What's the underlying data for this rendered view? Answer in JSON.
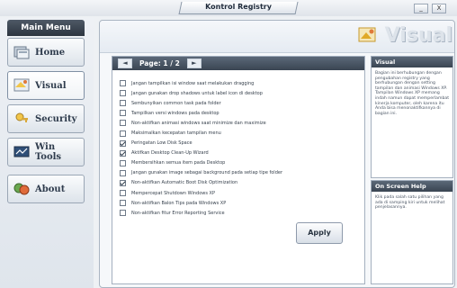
{
  "window": {
    "title": "Kontrol Registry",
    "minimize_label": "_",
    "close_label": "X"
  },
  "sidebar": {
    "title": "Main Menu",
    "items": [
      {
        "label": "Home",
        "icon": "home-icon"
      },
      {
        "label": "Visual",
        "icon": "visual-icon",
        "active": true
      },
      {
        "label": "Security",
        "icon": "security-icon"
      },
      {
        "label": "Win Tools",
        "icon": "wintools-icon"
      },
      {
        "label": "About",
        "icon": "about-icon"
      }
    ]
  },
  "banner": {
    "title": "Visual"
  },
  "options": {
    "page_label": "Page: 1 / 2",
    "prev_label": "◄",
    "next_label": "►",
    "items": [
      {
        "label": "Jangan tampilkan isi window saat melakukan dragging",
        "checked": false
      },
      {
        "label": "Jangan gunakan drop shadows untuk label icon di desktop",
        "checked": false
      },
      {
        "label": "Sembunyikan common task pada folder",
        "checked": false
      },
      {
        "label": "Tampilkan versi windows pada desktop",
        "checked": false
      },
      {
        "label": "Non-aktifkan animasi windows saat minimize dan maximize",
        "checked": false
      },
      {
        "label": "Maksimalkan kecepatan tampilan menu",
        "checked": false
      },
      {
        "label": "Peringatan Low Disk Space",
        "checked": true
      },
      {
        "label": "Aktifkan Desktop Clean-Up Wizard",
        "checked": true
      },
      {
        "label": "Membersihkan semua item pada Desktop",
        "checked": false
      },
      {
        "label": "Jangan gunakan image sebagai background pada setiap tipe folder",
        "checked": false
      },
      {
        "label": "Non-aktifkan Automatic Boot Disk Optimization",
        "checked": true
      },
      {
        "label": "Mempercepat Shutdown Windows XP",
        "checked": false
      },
      {
        "label": "Non-aktifkan Balon Tips pada Windows XP",
        "checked": false
      },
      {
        "label": "Non-aktifkan fitur Error Reporting Service",
        "checked": false
      }
    ],
    "apply_label": "Apply"
  },
  "info_panels": [
    {
      "title": "Visual",
      "body": "Bagian ini berhubungan dengan pengubahan registry yang berhubungan dengan setting tampilan dan animasi Windows XP. Tampilan Windows XP memang indah namun dapat memperlambat kinerja komputer, oleh karena itu Anda bisa menonaktifkannya di bagian ini."
    },
    {
      "title": "On Screen Help",
      "body": "Klik pada salah satu pilihan yang ada di samping kiri untuk melihat penjelasannya."
    }
  ],
  "colors": {
    "header_dark": "#3a4552",
    "panel_border": "#a4b0bf",
    "accent_yellow": "#f2c64a"
  }
}
